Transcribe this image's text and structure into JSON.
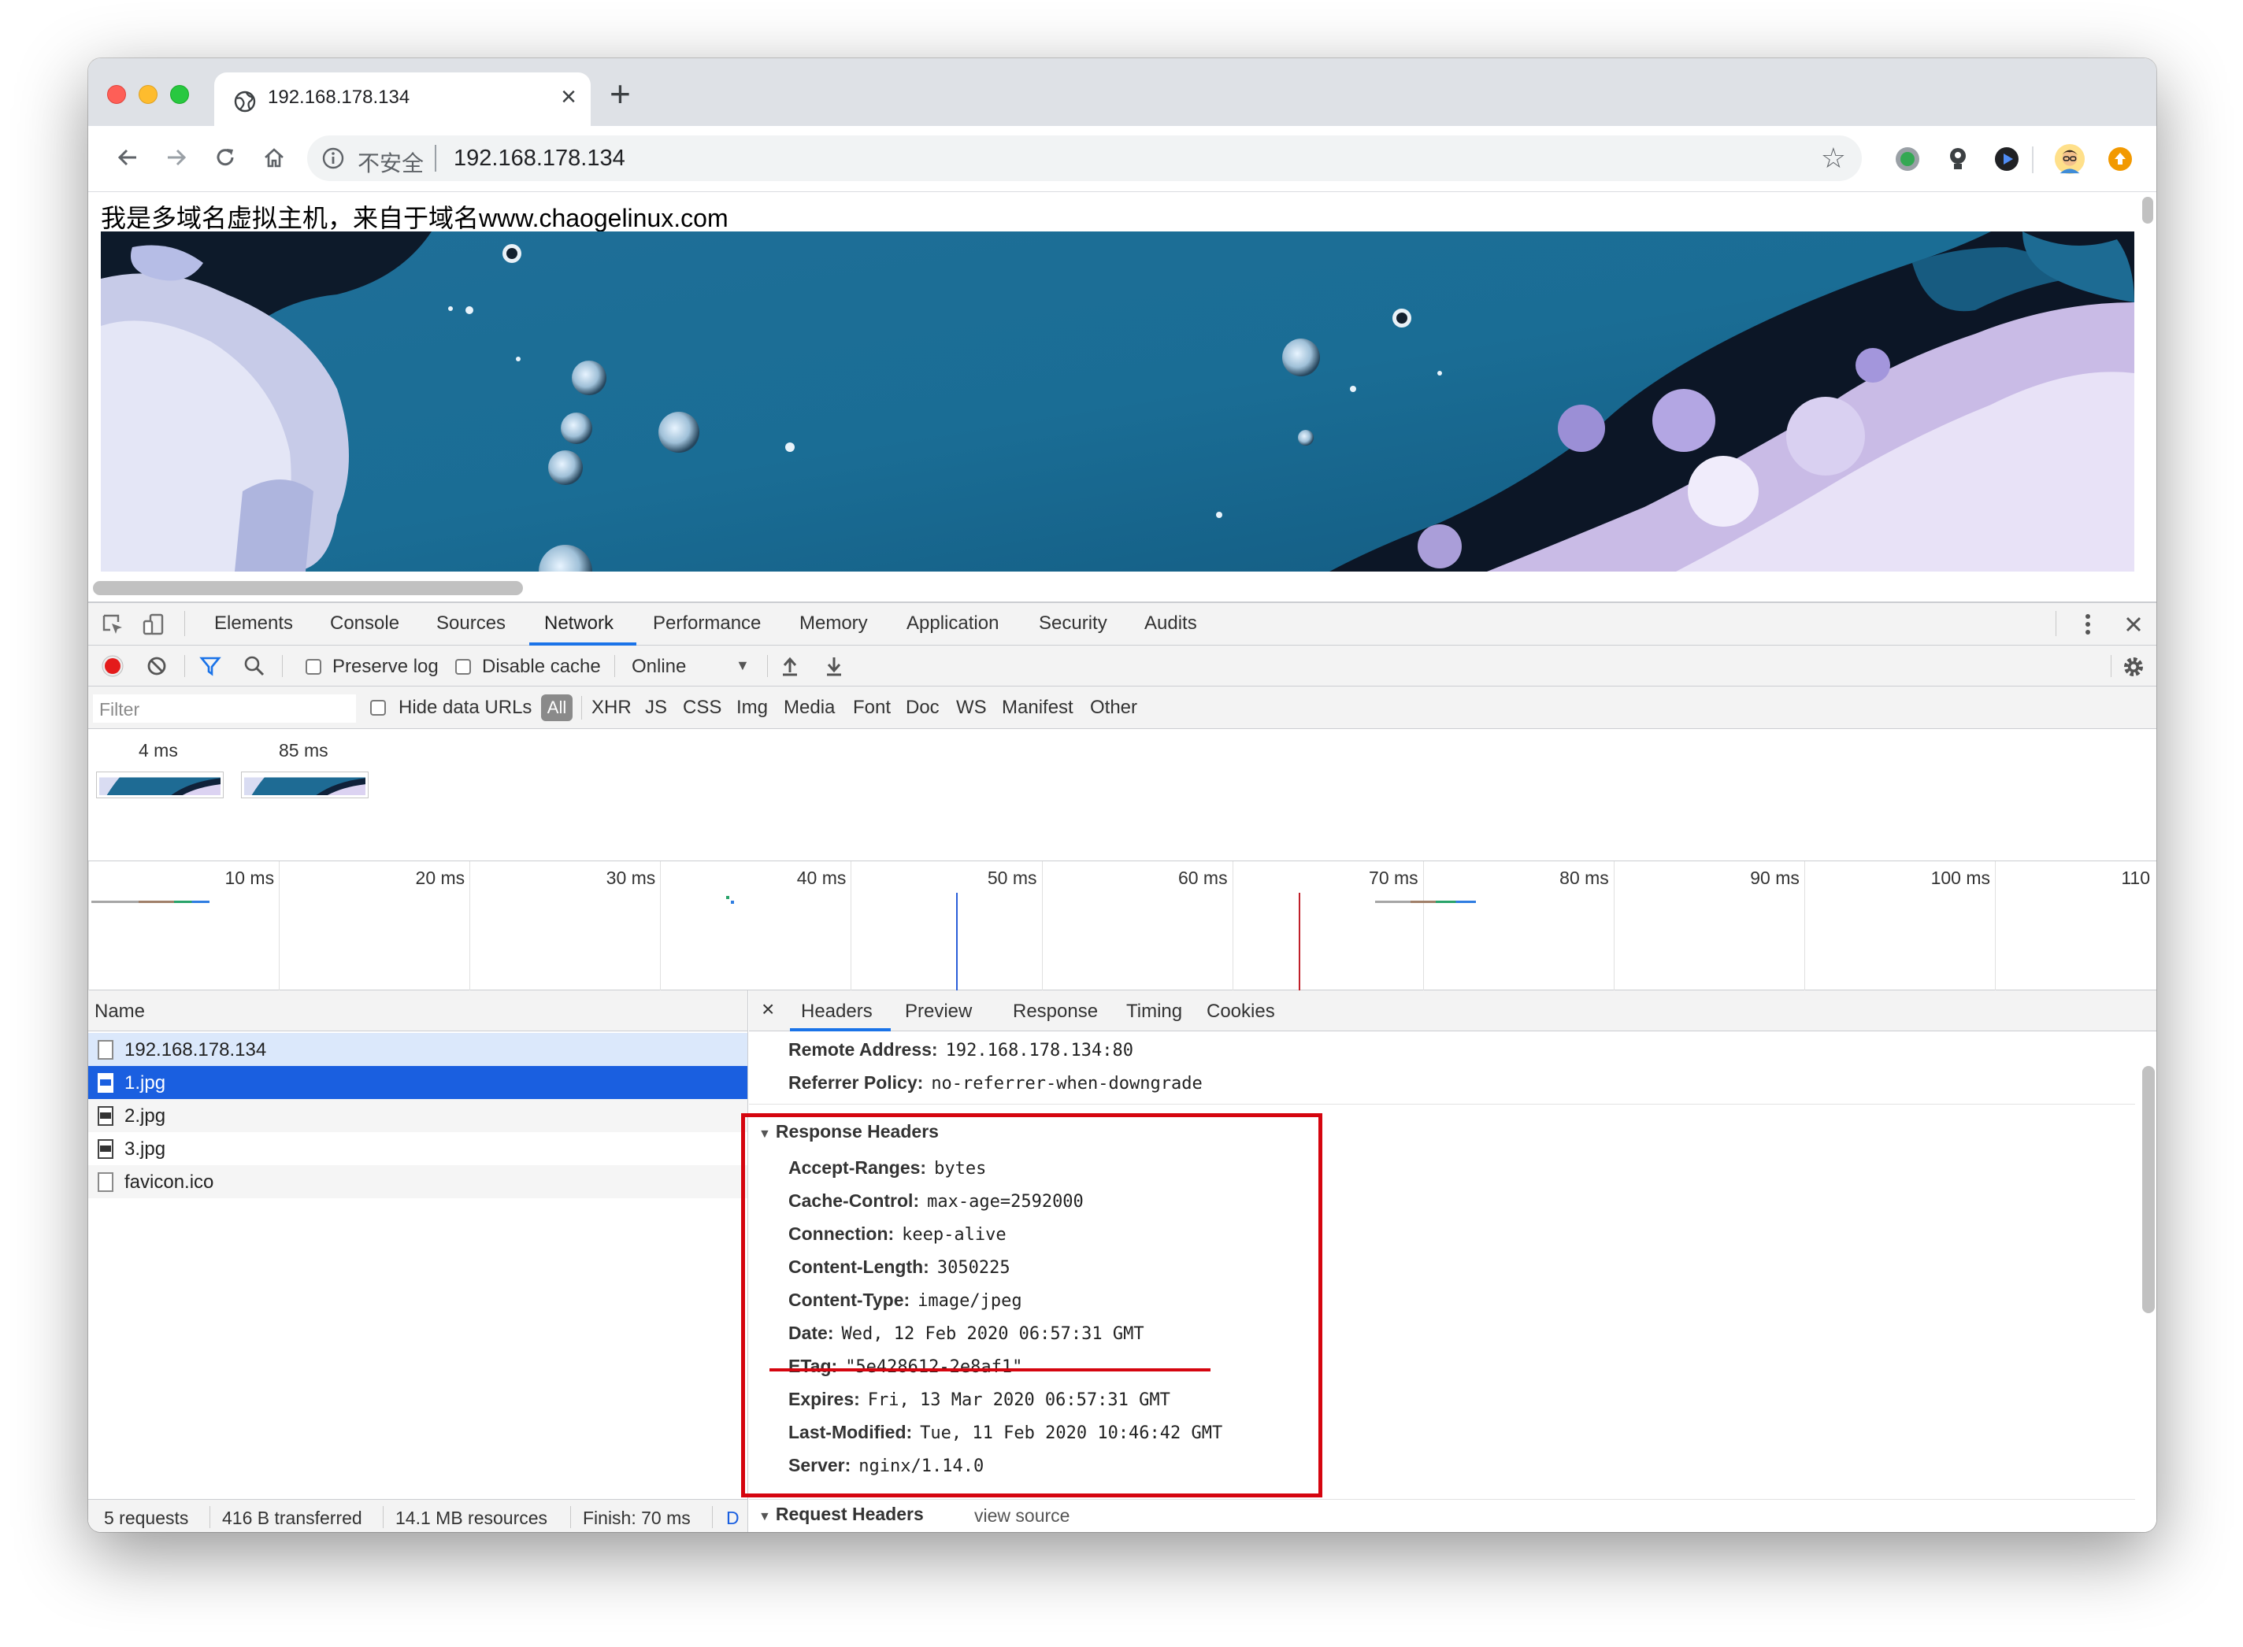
{
  "browser": {
    "tab_title": "192.168.178.134",
    "url_security_label": "不安全",
    "url": "192.168.178.134"
  },
  "page": {
    "heading": "我是多域名虚拟主机，来自于域名www.chaogelinux.com"
  },
  "devtools": {
    "tabs": [
      "Elements",
      "Console",
      "Sources",
      "Network",
      "Performance",
      "Memory",
      "Application",
      "Security",
      "Audits"
    ],
    "active_tab": "Network",
    "toolbar": {
      "preserve_log": "Preserve log",
      "disable_cache": "Disable cache",
      "throttle": "Online"
    },
    "filter": {
      "placeholder": "Filter",
      "hide_data_urls": "Hide data URLs",
      "all": "All",
      "types": [
        "XHR",
        "JS",
        "CSS",
        "Img",
        "Media",
        "Font",
        "Doc",
        "WS",
        "Manifest",
        "Other"
      ]
    },
    "screenshots": [
      {
        "label": "4 ms"
      },
      {
        "label": "85 ms"
      }
    ],
    "timeline": {
      "ticks": [
        "10 ms",
        "20 ms",
        "30 ms",
        "40 ms",
        "50 ms",
        "60 ms",
        "70 ms",
        "80 ms",
        "90 ms",
        "100 ms",
        "110"
      ],
      "dom_content_loaded_ms": 45.5,
      "load_ms": 63.5
    },
    "requests": {
      "header": "Name",
      "items": [
        {
          "name": "192.168.178.134",
          "type": "doc"
        },
        {
          "name": "1.jpg",
          "type": "img",
          "selected": true
        },
        {
          "name": "2.jpg",
          "type": "img"
        },
        {
          "name": "3.jpg",
          "type": "img"
        },
        {
          "name": "favicon.ico",
          "type": "doc"
        }
      ]
    },
    "status": {
      "requests": "5 requests",
      "transferred": "416 B transferred",
      "resources": "14.1 MB resources",
      "finish": "Finish: 70 ms",
      "truncated": "D"
    },
    "details": {
      "close": "×",
      "tabs": [
        "Headers",
        "Preview",
        "Response",
        "Timing",
        "Cookies"
      ],
      "active_tab": "Headers",
      "general": [
        {
          "key": "Remote Address:",
          "value": "192.168.178.134:80"
        },
        {
          "key": "Referrer Policy:",
          "value": "no-referrer-when-downgrade"
        }
      ],
      "response_headers_title": "Response Headers",
      "response_headers": [
        {
          "key": "Accept-Ranges:",
          "value": "bytes"
        },
        {
          "key": "Cache-Control:",
          "value": "max-age=2592000"
        },
        {
          "key": "Connection:",
          "value": "keep-alive"
        },
        {
          "key": "Content-Length:",
          "value": "3050225"
        },
        {
          "key": "Content-Type:",
          "value": "image/jpeg"
        },
        {
          "key": "Date:",
          "value": "Wed, 12 Feb 2020 06:57:31 GMT"
        },
        {
          "key": "ETag:",
          "value": "\"5e428612-2e8af1\""
        },
        {
          "key": "Expires:",
          "value": "Fri, 13 Mar 2020 06:57:31 GMT"
        },
        {
          "key": "Last-Modified:",
          "value": "Tue, 11 Feb 2020 10:46:42 GMT"
        },
        {
          "key": "Server:",
          "value": "nginx/1.14.0"
        }
      ],
      "request_headers_title": "Request Headers",
      "view_source": "view source"
    }
  },
  "colors": {
    "selected_row": "#1a5fe0",
    "highlight_box": "#d5050f",
    "dcl_line": "#2b5fd9",
    "load_line": "#c0202a"
  }
}
